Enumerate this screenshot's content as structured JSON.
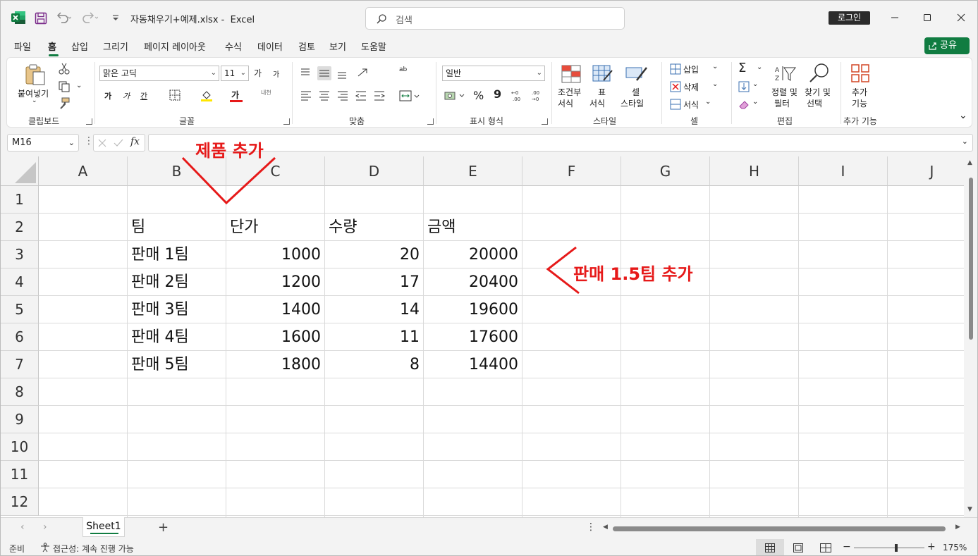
{
  "titlebar": {
    "filename": "자동채우기+예제.xlsx",
    "separator": " -  ",
    "app": "Excel",
    "search_placeholder": "검색",
    "login": "로그인"
  },
  "tabs": [
    "파일",
    "홈",
    "삽입",
    "그리기",
    "페이지 레이아웃",
    "수식",
    "데이터",
    "검토",
    "보기",
    "도움말"
  ],
  "active_tab": "홈",
  "share": "공유",
  "ribbon": {
    "clipboard": {
      "paste": "붙여넣기",
      "label": "클립보드"
    },
    "font": {
      "name": "맑은 고딕",
      "size": "11",
      "grow": "가",
      "shrink": "가",
      "bold": "가",
      "italic": "가",
      "underline": "간",
      "color": "가",
      "phonetic": "내천",
      "label": "글꼴"
    },
    "alignment": {
      "wrap": "ab",
      "label": "맞춤"
    },
    "number": {
      "format": "일반",
      "percent": "%",
      "comma": "9",
      "label": "표시 형식"
    },
    "styles": {
      "conditional_1": "조건부",
      "conditional_2": "서식",
      "table_1": "표",
      "table_2": "서식",
      "cell_1": "셀",
      "cell_2": "스타일",
      "label": "스타일"
    },
    "cells": {
      "insert": "삽입",
      "delete": "삭제",
      "format": "서식",
      "label": "셀"
    },
    "editing": {
      "sort_1": "정렬 및",
      "sort_2": "필터",
      "find_1": "찾기 및",
      "find_2": "선택",
      "label": "편집"
    },
    "addins": {
      "addin_1": "추가",
      "addin_2": "기능",
      "label": "추가 기능"
    }
  },
  "formula_bar": {
    "name_box": "M16",
    "fx": "fx",
    "value": ""
  },
  "columns": [
    "A",
    "B",
    "C",
    "D",
    "E",
    "F",
    "G",
    "H",
    "I",
    "J"
  ],
  "rows": [
    "1",
    "2",
    "3",
    "4",
    "5",
    "6",
    "7",
    "8",
    "9",
    "10",
    "11",
    "12"
  ],
  "cells": {
    "B2": "팀",
    "C2": "단가",
    "D2": "수량",
    "E2": "금액",
    "B3": "판매 1팀",
    "C3": "1000",
    "D3": "20",
    "E3": "20000",
    "B4": "판매 2팀",
    "C4": "1200",
    "D4": "17",
    "E4": "20400",
    "B5": "판매 3팀",
    "C5": "1400",
    "D5": "14",
    "E5": "19600",
    "B6": "판매 4팀",
    "C6": "1600",
    "D6": "11",
    "E6": "17600",
    "B7": "판매 5팀",
    "C7": "1800",
    "D7": "8",
    "E7": "14400"
  },
  "annotations": {
    "top": "제품 추가",
    "right": "판매 1.5팀 추가",
    "color": "#e61919"
  },
  "sheets": [
    "Sheet1"
  ],
  "status": {
    "ready": "준비",
    "accessibility": "접근성: 계속 진행 가능",
    "zoom": "175%"
  },
  "colors": {
    "accent": "#107c41"
  }
}
